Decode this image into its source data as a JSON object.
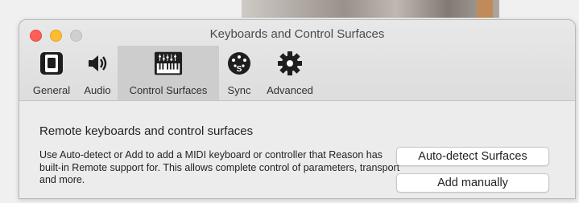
{
  "window": {
    "title": "Keyboards and Control Surfaces"
  },
  "toolbar": {
    "tabs": [
      {
        "label": "General",
        "icon": "switch-icon"
      },
      {
        "label": "Audio",
        "icon": "speaker-icon"
      },
      {
        "label": "Control Surfaces",
        "icon": "midi-keyboard-icon",
        "selected": true
      },
      {
        "label": "Sync",
        "icon": "sync-connector-icon"
      },
      {
        "label": "Advanced",
        "icon": "gear-icon"
      }
    ]
  },
  "main": {
    "section_title": "Remote keyboards and control surfaces",
    "description": "Use Auto-detect or Add to add a MIDI keyboard or controller that Reason has built-in Remote support for. This allows complete control of parameters, transport and more.",
    "auto_detect_label": "Auto-detect Surfaces",
    "add_manually_label": "Add manually"
  },
  "colors": {
    "close": "#fe5f57",
    "minimize": "#febc2e",
    "zoom_inactive": "#cfcfcf",
    "selected_tab": "#cdcdcd"
  }
}
